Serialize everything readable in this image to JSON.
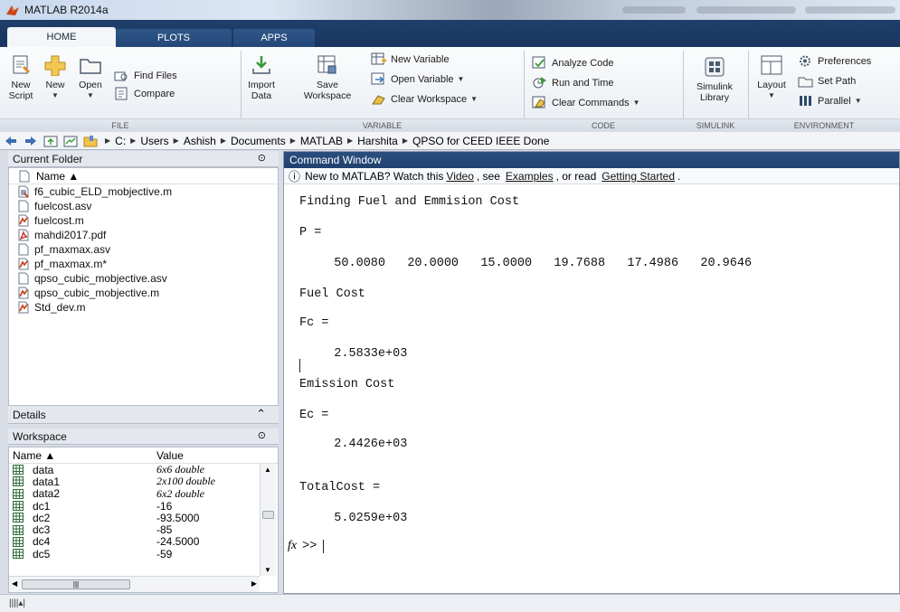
{
  "window": {
    "title": "MATLAB R2014a"
  },
  "tabs": [
    {
      "label": "HOME"
    },
    {
      "label": "PLOTS"
    },
    {
      "label": "APPS"
    }
  ],
  "ribbon": {
    "file": {
      "group_label": "FILE",
      "new_script": "New\nScript",
      "new": "New",
      "open": "Open",
      "find_files": "Find Files",
      "compare": "Compare"
    },
    "variable": {
      "group_label": "VARIABLE",
      "import_data": "Import\nData",
      "save_workspace": "Save\nWorkspace",
      "new_variable": "New Variable",
      "open_variable": "Open Variable",
      "clear_workspace": "Clear Workspace"
    },
    "code": {
      "group_label": "CODE",
      "analyze_code": "Analyze Code",
      "run_and_time": "Run and Time",
      "clear_commands": "Clear Commands"
    },
    "simulink": {
      "group_label": "SIMULINK",
      "simulink_library": "Simulink\nLibrary"
    },
    "environment": {
      "group_label": "ENVIRONMENT",
      "layout": "Layout",
      "preferences": "Preferences",
      "set_path": "Set Path",
      "parallel": "Parallel"
    }
  },
  "address": {
    "path": [
      "C:",
      "Users",
      "Ashish",
      "Documents",
      "MATLAB",
      "Harshita",
      "QPSO for CEED IEEE Done"
    ]
  },
  "current_folder": {
    "title": "Current Folder",
    "column": "Name ▲",
    "files": [
      {
        "name": "f6_cubic_ELD_mobjective.m",
        "icon": "script-file-icon"
      },
      {
        "name": "fuelcost.asv",
        "icon": "blank-file-icon"
      },
      {
        "name": "fuelcost.m",
        "icon": "function-file-icon"
      },
      {
        "name": "mahdi2017.pdf",
        "icon": "pdf-file-icon"
      },
      {
        "name": "pf_maxmax.asv",
        "icon": "blank-file-icon"
      },
      {
        "name": "pf_maxmax.m*",
        "icon": "function-file-icon"
      },
      {
        "name": "qpso_cubic_mobjective.asv",
        "icon": "blank-file-icon"
      },
      {
        "name": "qpso_cubic_mobjective.m",
        "icon": "function-file-icon"
      },
      {
        "name": "Std_dev.m",
        "icon": "function-file-icon"
      }
    ]
  },
  "details": {
    "title": "Details"
  },
  "workspace": {
    "title": "Workspace",
    "col_name": "Name ▲",
    "col_value": "Value",
    "rows": [
      {
        "name": "data",
        "value": "6x6 double",
        "italic": true
      },
      {
        "name": "data1",
        "value": "2x100 double",
        "italic": true
      },
      {
        "name": "data2",
        "value": "6x2 double",
        "italic": true
      },
      {
        "name": "dc1",
        "value": "-16",
        "italic": false
      },
      {
        "name": "dc2",
        "value": "-93.5000",
        "italic": false
      },
      {
        "name": "dc3",
        "value": "-85",
        "italic": false
      },
      {
        "name": "dc4",
        "value": "-24.5000",
        "italic": false
      },
      {
        "name": "dc5",
        "value": "-59",
        "italic": false
      }
    ]
  },
  "command_window": {
    "title": "Command Window",
    "info": {
      "prefix": "New to MATLAB? Watch this",
      "video": "Video",
      "mid1": ", see",
      "examples": "Examples",
      "mid2": ", or read",
      "getting_started": "Getting Started",
      "suffix": "."
    },
    "lines": {
      "l1": "Finding Fuel and Emmision Cost",
      "l2": "P =",
      "l3": "   50.0080   20.0000   15.0000   19.7688   17.4986   20.9646",
      "l4": "Fuel Cost",
      "l5": "Fc =",
      "l6": "   2.5833e+03",
      "l7": "Emission Cost",
      "l8": "Ec =",
      "l9": "   2.4426e+03",
      "l10": "TotalCost =",
      "l11": "   5.0259e+03"
    },
    "prompt_fx": "fx",
    "prompt": ">>"
  },
  "colors": {
    "tabbar": "#1f3f6b",
    "cmd_header": "#2a4f7e",
    "ribbon_bg": "#f4f6f9"
  }
}
